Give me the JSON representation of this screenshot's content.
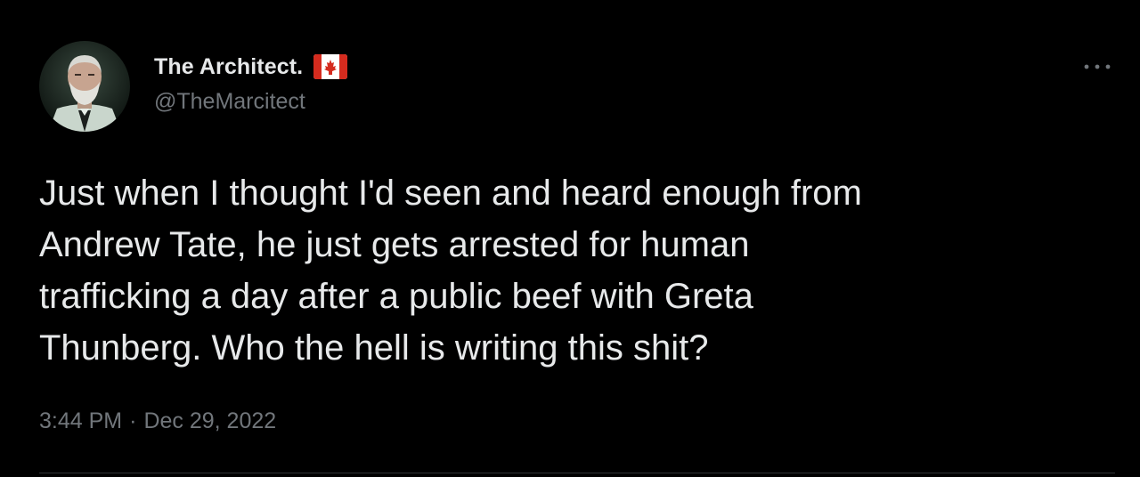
{
  "tweet": {
    "author": {
      "display_name": "The Architect.",
      "handle": "@TheMarcitect",
      "flag_icon": "canada-flag-icon"
    },
    "text": "Just when I thought I'd seen and heard enough from\nAndrew Tate, he just gets arrested for human\ntrafficking a day after a public beef with Greta\nThunberg. Who the hell is writing this shit?",
    "time": "3:44 PM",
    "separator": "·",
    "date": "Dec 29, 2022",
    "more_icon": "more-options-icon"
  },
  "colors": {
    "background": "#000000",
    "primary_text": "#e7e9ea",
    "secondary_text": "#71767b",
    "divider": "#2f3336",
    "flag_red": "#d52b1e"
  }
}
